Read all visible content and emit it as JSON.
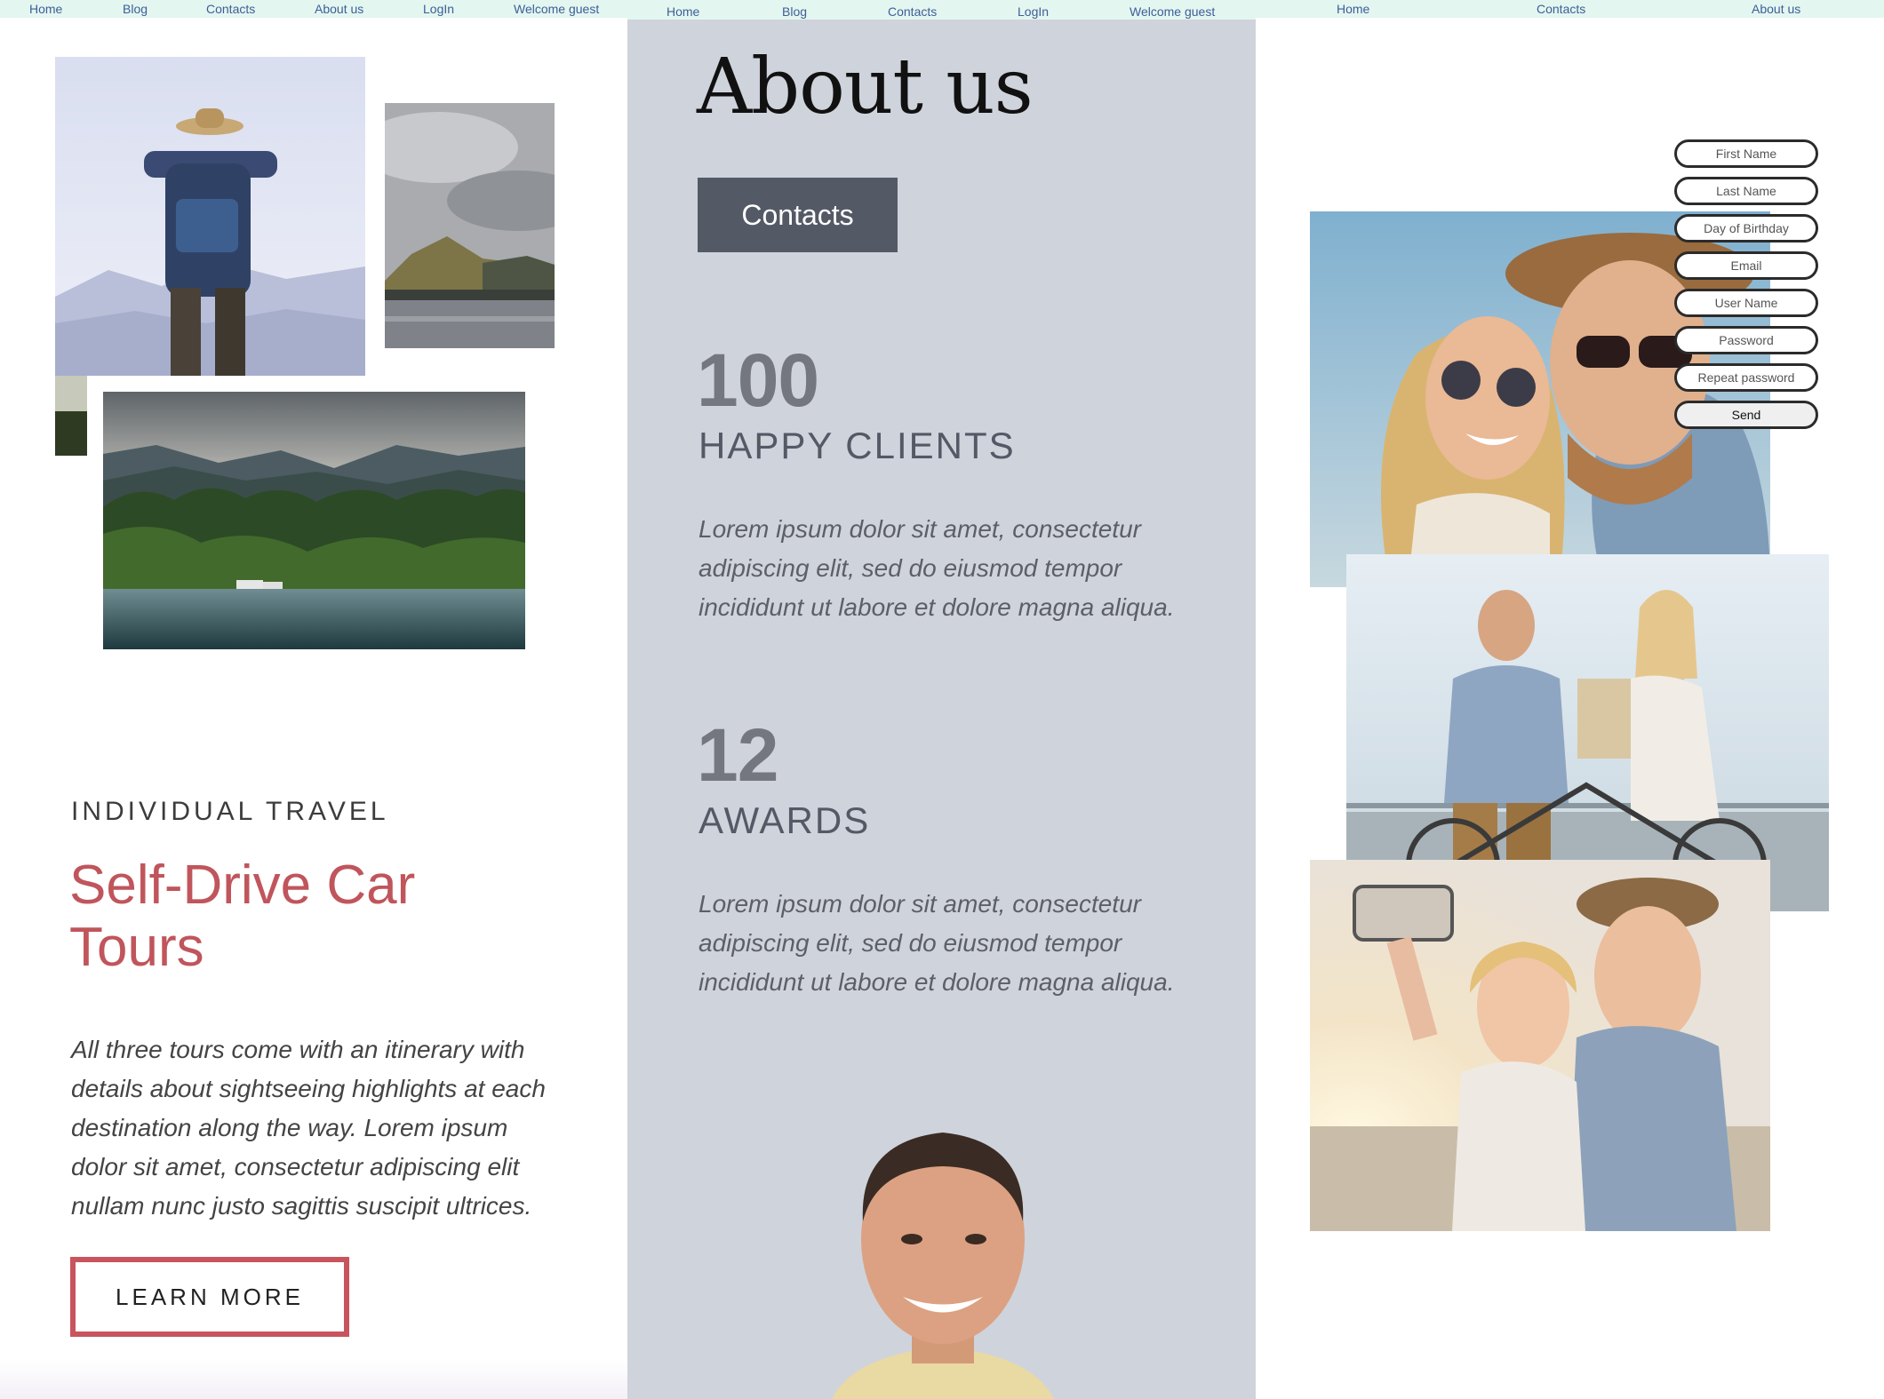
{
  "panel1": {
    "nav": [
      "Home",
      "Blog",
      "Contacts",
      "About us",
      "LogIn",
      "Welcome guest"
    ],
    "eyebrow": "INDIVIDUAL TRAVEL",
    "title": "Self-Drive Car Tours",
    "description": "All three tours come with an itinerary with details about sightseeing highlights at each destination along the way. Lorem ipsum dolor sit amet, consectetur adipiscing elit nullam nunc justo sagittis suscipit ultrices.",
    "cta": "LEARN MORE"
  },
  "panel2": {
    "nav": [
      "Home",
      "Blog",
      "Contacts",
      "LogIn",
      "Welcome guest"
    ],
    "title": "About us",
    "contacts_button": "Contacts",
    "stats": [
      {
        "number": "100",
        "label": "HAPPY CLIENTS",
        "text": "Lorem ipsum dolor sit amet, consectetur adipiscing elit, sed do eiusmod tempor incididunt ut labore et dolore magna aliqua."
      },
      {
        "number": "12",
        "label": "AWARDS",
        "text": "Lorem ipsum dolor sit amet, consectetur adipiscing elit, sed do eiusmod tempor incididunt ut labore et dolore magna aliqua."
      }
    ]
  },
  "panel3": {
    "nav": [
      "Home",
      "Contacts",
      "About us"
    ],
    "form": {
      "fields": [
        "First Name",
        "Last Name",
        "Day of Birthday",
        "Email",
        "User Name",
        "Password",
        "Repeat password"
      ],
      "submit": "Send"
    }
  }
}
